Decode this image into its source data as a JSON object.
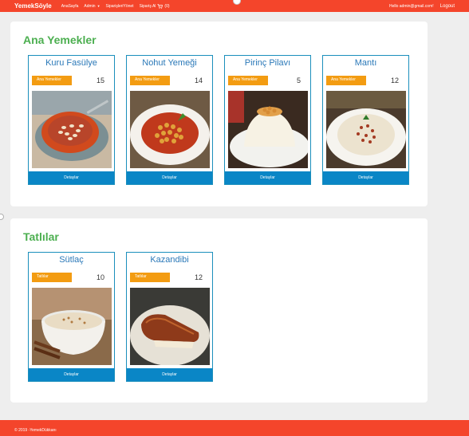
{
  "nav": {
    "brand": "YemekSöyle",
    "links": [
      "AnaSayfa",
      "Admin",
      "SiparişleriYönet",
      "Sipariş Al"
    ],
    "cart_count": "(0)",
    "email": "Hello admin@gmail.com!",
    "logout": "Logout"
  },
  "sections": [
    {
      "title": "Ana Yemekler",
      "items": [
        {
          "name": "Kuru Fasülye",
          "category": "Ana Yemekler",
          "count": "15",
          "button": "Detaylar"
        },
        {
          "name": "Nohut Yemeği",
          "category": "Ana Yemekler",
          "count": "14",
          "button": "Detaylar"
        },
        {
          "name": "Pirinç Pilavı",
          "category": "Ana Yemekler",
          "count": "5",
          "button": "Detaylar"
        },
        {
          "name": "Mantı",
          "category": "Ana Yemekler",
          "count": "12",
          "button": "Detaylar"
        }
      ]
    },
    {
      "title": "Tatlılar",
      "items": [
        {
          "name": "Sütlaç",
          "category": "Tatlılar",
          "count": "10",
          "button": "Detaylar"
        },
        {
          "name": "Kazandibi",
          "category": "Tatlılar",
          "count": "12",
          "button": "Detaylar"
        }
      ]
    }
  ],
  "footer": "© 2019 -YemekDükkanı",
  "colors": {
    "brand": "#f4452b",
    "title_green": "#4caf50",
    "card_border": "#1b8fbc",
    "badge": "#f39c12",
    "button": "#0a86c6"
  }
}
